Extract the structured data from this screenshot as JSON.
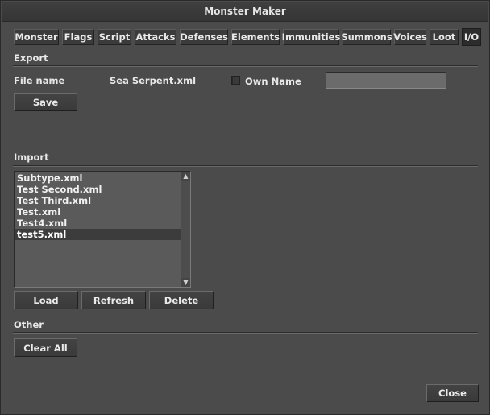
{
  "window": {
    "title": "Monster Maker"
  },
  "tabs": [
    {
      "label": "Monster"
    },
    {
      "label": "Flags"
    },
    {
      "label": "Script"
    },
    {
      "label": "Attacks"
    },
    {
      "label": "Defenses"
    },
    {
      "label": "Elements"
    },
    {
      "label": "Immunities"
    },
    {
      "label": "Summons"
    },
    {
      "label": "Voices"
    },
    {
      "label": "Loot"
    },
    {
      "label": "I/O"
    }
  ],
  "export": {
    "section_label": "Export",
    "file_name_label": "File name",
    "file_name_value": "Sea Serpent.xml",
    "own_name_label": "Own Name",
    "own_name_checked": false,
    "own_name_value": "",
    "save_label": "Save"
  },
  "import": {
    "section_label": "Import",
    "files": [
      "Subtype.xml",
      "Test Second.xml",
      "Test Third.xml",
      "Test.xml",
      "Test4.xml",
      "test5.xml"
    ],
    "selected_file": "test5.xml",
    "load_label": "Load",
    "refresh_label": "Refresh",
    "delete_label": "Delete"
  },
  "other": {
    "section_label": "Other",
    "clear_all_label": "Clear All"
  },
  "footer": {
    "close_label": "Close"
  }
}
